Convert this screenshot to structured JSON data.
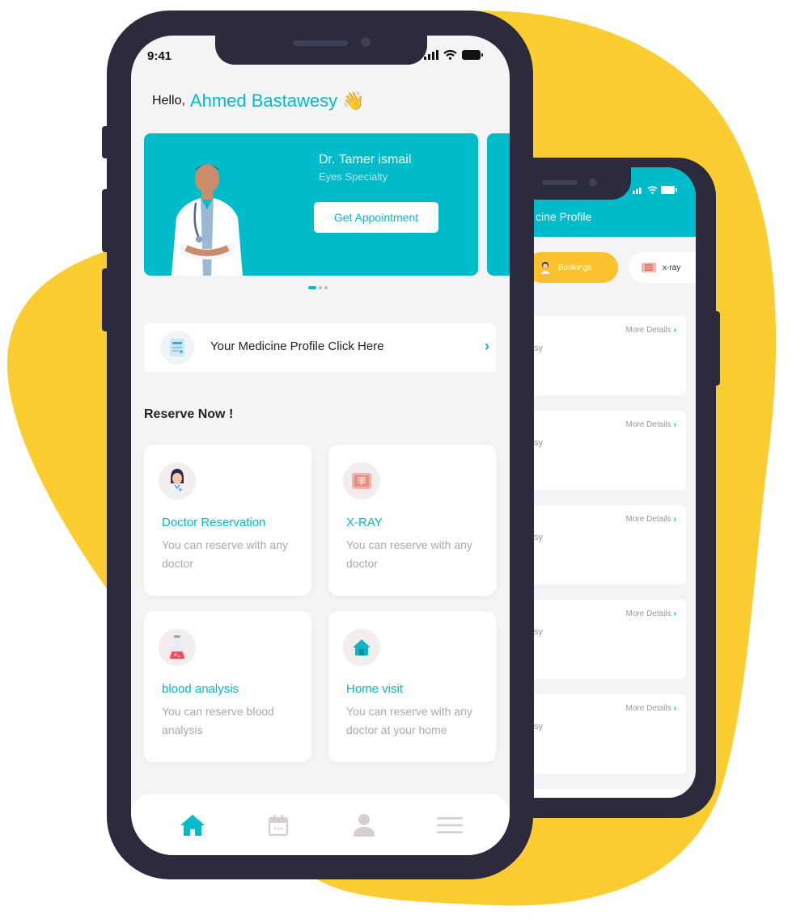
{
  "status_bar": {
    "time": "9:41"
  },
  "greeting": {
    "hello": "Hello,",
    "name": "Ahmed Bastawesy",
    "wave": "👋"
  },
  "banner": {
    "doctor_name": "Dr. Tamer ismail",
    "specialty": "Eyes Specialty",
    "button_label": "Get Appointment",
    "page_count": 3,
    "active_page": 1
  },
  "medicine_profile": {
    "label": "Your Medicine Profile Click Here",
    "chevron": "›"
  },
  "reserve": {
    "title": "Reserve Now !",
    "cards": [
      {
        "icon": "doctor-icon",
        "title": "Doctor Reservation",
        "desc": "You can reserve with any doctor"
      },
      {
        "icon": "xray-icon",
        "title": "X-RAY",
        "desc": "You can reserve with any doctor"
      },
      {
        "icon": "flask-icon",
        "title": "blood analysis",
        "desc": "You can reserve blood analysis"
      },
      {
        "icon": "home-icon",
        "title": "Home visit",
        "desc": "You can reserve with any doctor at your home"
      }
    ]
  },
  "bottom_nav": {
    "items": [
      {
        "icon": "home-icon",
        "active": true
      },
      {
        "icon": "calendar-icon",
        "active": false
      },
      {
        "icon": "user-icon",
        "active": false
      },
      {
        "icon": "menu-icon",
        "active": false
      }
    ]
  },
  "second_phone": {
    "title": "cine Profile",
    "tabs": [
      {
        "label": "Bookings",
        "icon": "doctor-icon"
      },
      {
        "label": "x-ray",
        "icon": "xray-icon"
      }
    ],
    "more_details": "More Details",
    "chevron": "›",
    "row_fragment": "sy"
  },
  "colors": {
    "primary": "#00bcca",
    "accent": "#fcc22e",
    "frame": "#2b2b3d",
    "background": "#f4f4f5"
  }
}
